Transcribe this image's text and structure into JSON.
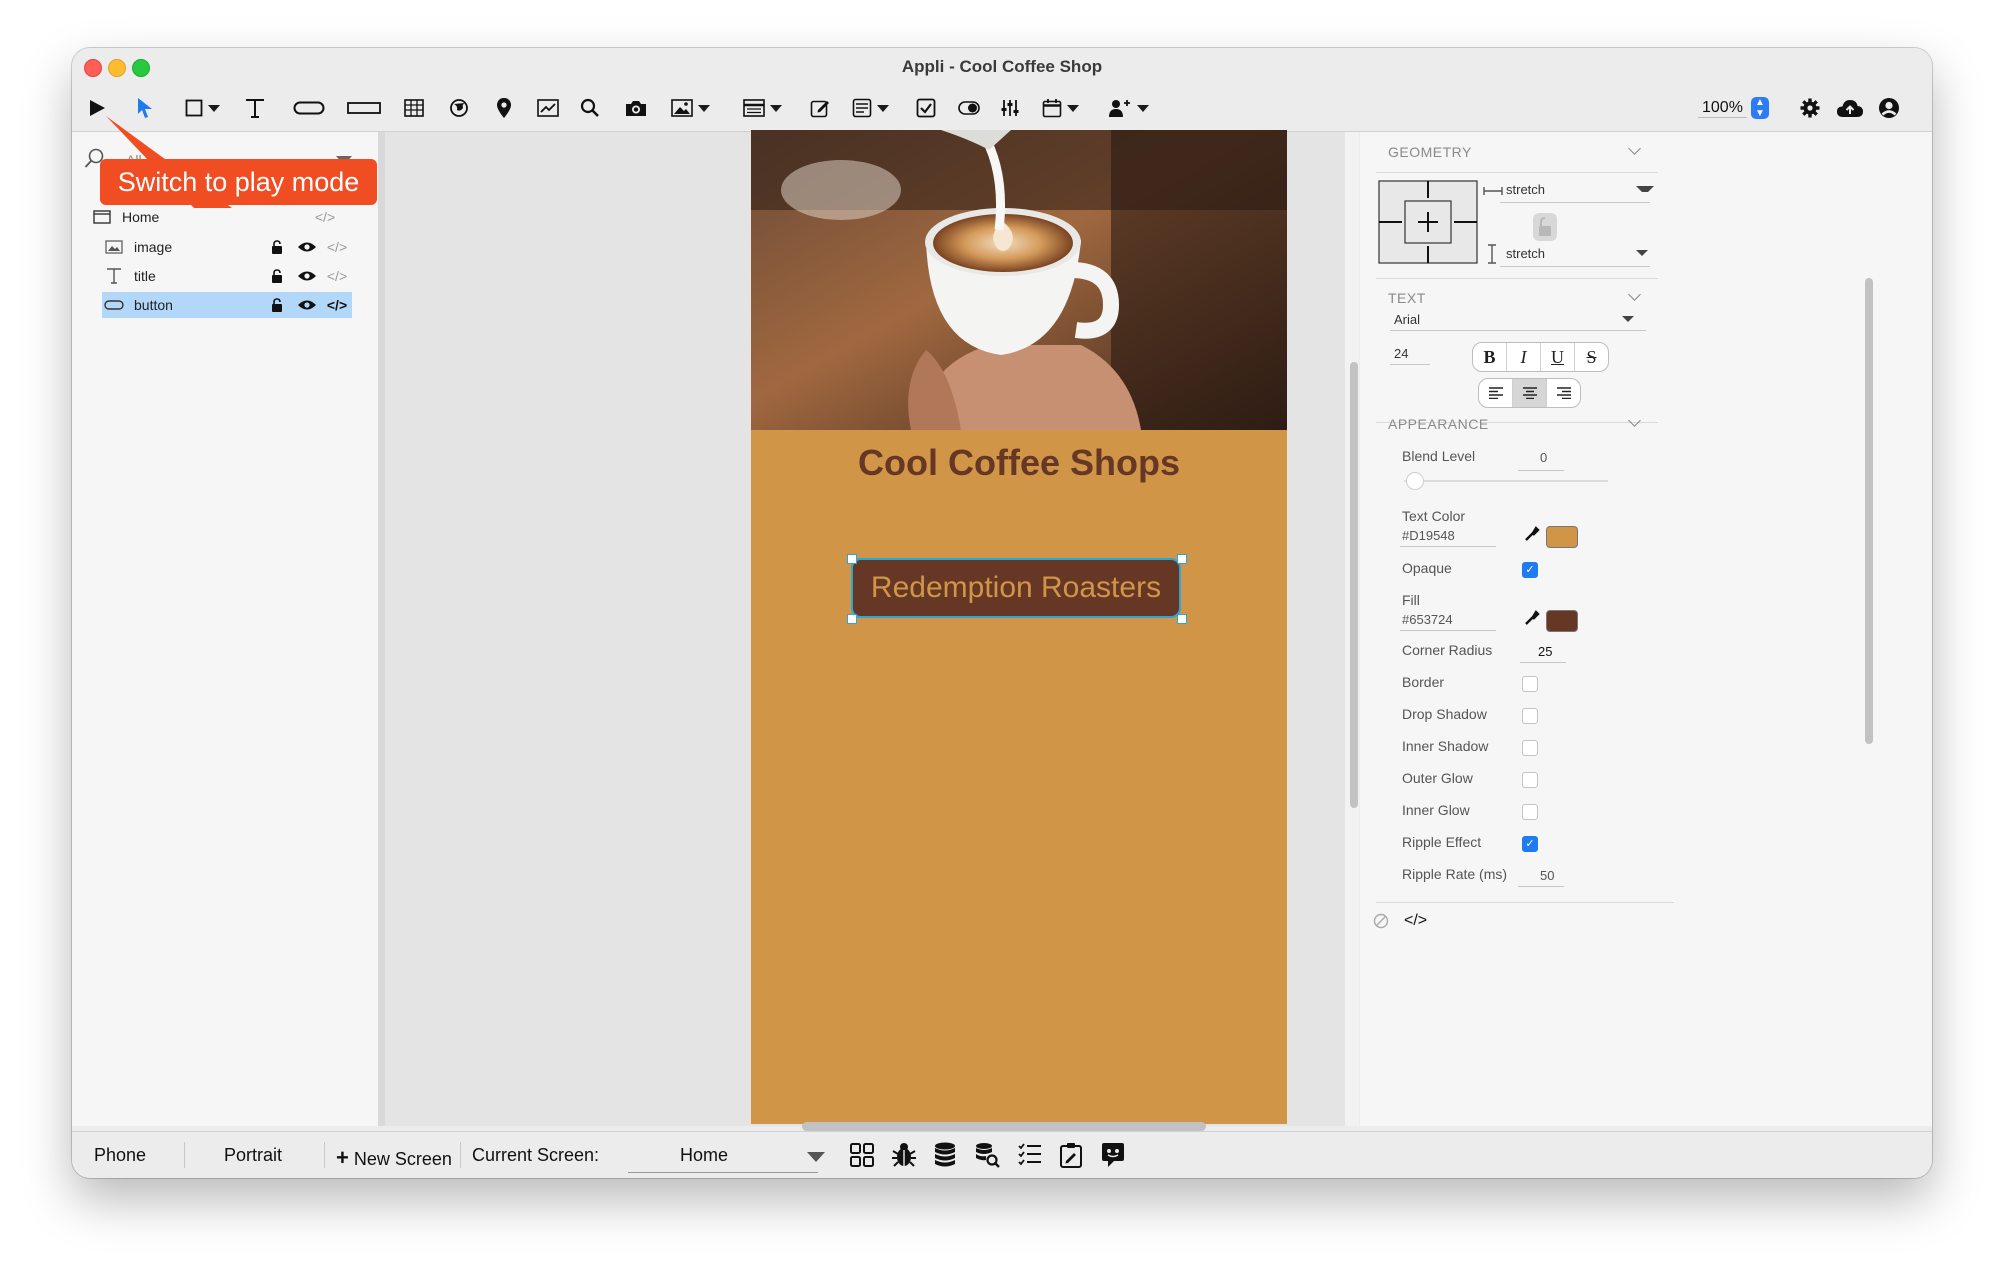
{
  "window": {
    "title": "Appli - Cool Coffee Shop"
  },
  "toolbar": {
    "zoom": "100%"
  },
  "callout": {
    "text": "Switch to play mode"
  },
  "layers_panel": {
    "search_placeholder": "All it",
    "items": [
      {
        "label": "Home",
        "icon": "screen-icon"
      },
      {
        "label": "image",
        "icon": "image-icon"
      },
      {
        "label": "title",
        "icon": "text-icon"
      },
      {
        "label": "button",
        "icon": "button-icon",
        "selected": true
      }
    ]
  },
  "app": {
    "title": "Cool Coffee Shops",
    "button_label": "Redemption Roasters",
    "background_color": "#D19548",
    "button_fill": "#653724"
  },
  "inspector": {
    "geometry": {
      "header": "GEOMETRY",
      "horizontal": "stretch",
      "vertical": "stretch"
    },
    "text": {
      "header": "TEXT",
      "font": "Arial",
      "size": "24"
    },
    "appearance": {
      "header": "APPEARANCE",
      "blend_level_label": "Blend Level",
      "blend_level": "0",
      "text_color_label": "Text Color",
      "text_color": "#D19548",
      "opaque_label": "Opaque",
      "fill_label": "Fill",
      "fill": "#653724",
      "corner_radius_label": "Corner Radius",
      "corner_radius": "25",
      "border_label": "Border",
      "drop_shadow_label": "Drop Shadow",
      "inner_shadow_label": "Inner Shadow",
      "outer_glow_label": "Outer Glow",
      "inner_glow_label": "Inner Glow",
      "ripple_effect_label": "Ripple Effect",
      "ripple_rate_label": "Ripple Rate (ms)",
      "ripple_rate": "50"
    }
  },
  "statusbar": {
    "device": "Phone",
    "orientation": "Portrait",
    "new_screen": "New Screen",
    "current_screen_label": "Current Screen:",
    "current_screen": "Home"
  }
}
